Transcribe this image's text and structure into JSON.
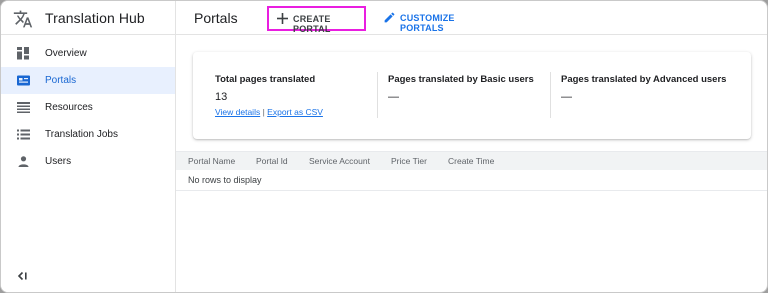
{
  "app": {
    "title": "Translation Hub",
    "icon": "translate-icon"
  },
  "sidebar": {
    "items": [
      {
        "label": "Overview",
        "icon": "dashboard-icon",
        "active": false
      },
      {
        "label": "Portals",
        "icon": "portal-icon",
        "active": true
      },
      {
        "label": "Resources",
        "icon": "resources-icon",
        "active": false
      },
      {
        "label": "Translation Jobs",
        "icon": "list-icon",
        "active": false
      },
      {
        "label": "Users",
        "icon": "person-icon",
        "active": false
      }
    ],
    "collapse_icon": "collapse-sidebar-icon"
  },
  "header": {
    "title": "Portals",
    "create_label": "CREATE PORTAL",
    "customize_label": "CUSTOMIZE PORTALS"
  },
  "stats": {
    "total": {
      "title": "Total pages translated",
      "value": "13",
      "view_details": "View details",
      "separator": "|",
      "export_csv": "Export as CSV"
    },
    "basic": {
      "title": "Pages translated by Basic users",
      "value": "—"
    },
    "advanced": {
      "title": "Pages translated by Advanced users",
      "value": "—"
    }
  },
  "table": {
    "columns": [
      "Portal Name",
      "Portal Id",
      "Service Account",
      "Price Tier",
      "Create Time"
    ],
    "empty_text": "No rows to display"
  },
  "colors": {
    "accent": "#1a73e8",
    "active_nav_bg": "#e8f0fe",
    "highlight_border": "#e91ee0"
  }
}
